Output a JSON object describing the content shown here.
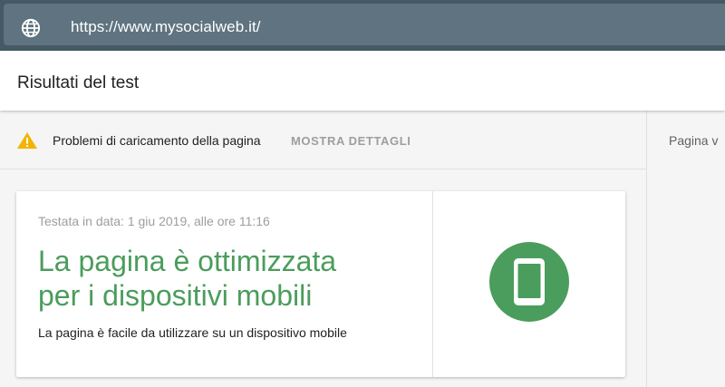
{
  "urlbar": {
    "url": "https://www.mysocialweb.it/",
    "icon": "globe-icon"
  },
  "header": {
    "title": "Risultati del test"
  },
  "warning": {
    "icon": "warning-icon",
    "color": "#f4b400",
    "text": "Problemi di caricamento della pagina",
    "link": "MOSTRA DETTAGLI"
  },
  "right_pane": {
    "label": "Pagina v"
  },
  "result_card": {
    "tested_date": "Testata in data: 1 giu 2019, alle ore 11:16",
    "title_line1": "La pagina è ottimizzata",
    "title_line2": "per i dispositivi mobili",
    "subtitle": "La pagina è facile da utilizzare su un dispositivo mobile",
    "icon": "mobile-phone-icon",
    "accent_color": "#4a9d5c"
  }
}
